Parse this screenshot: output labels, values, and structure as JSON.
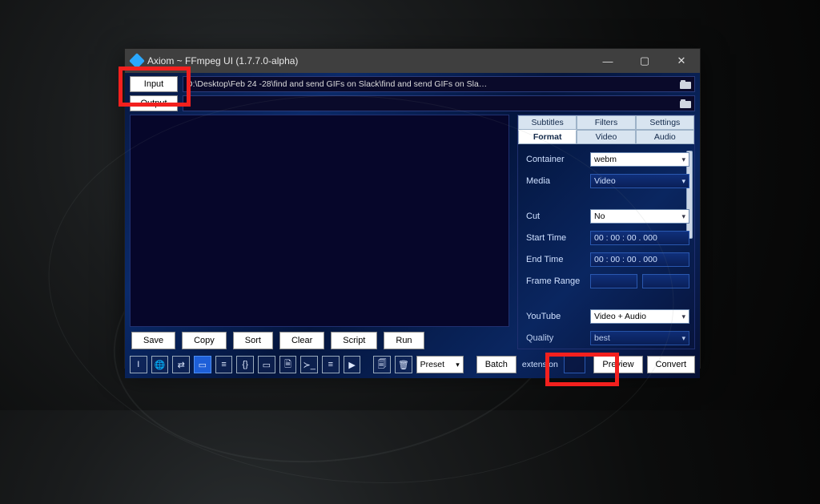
{
  "window": {
    "title": "Axiom ~ FFmpeg UI (1.7.7.0-alpha)"
  },
  "io": {
    "input_label": "Input",
    "input_path": "D:\\Desktop\\Feb 24 -28\\find and send GIFs on Slack\\find and send GIFs on Sla…",
    "output_label": "Output",
    "output_path": ""
  },
  "actions": {
    "save": "Save",
    "copy": "Copy",
    "sort": "Sort",
    "clear": "Clear",
    "script": "Script",
    "run": "Run"
  },
  "tabs_top": [
    "Subtitles",
    "Filters",
    "Settings"
  ],
  "tabs_bottom": [
    "Format",
    "Video",
    "Audio"
  ],
  "tabs_active_bottom": "Format",
  "settings": {
    "container_label": "Container",
    "container_value": "webm",
    "media_label": "Media",
    "media_value": "Video",
    "cut_label": "Cut",
    "cut_value": "No",
    "start_label": "Start Time",
    "start_value": "00 : 00 : 00 . 000",
    "end_label": "End Time",
    "end_value": "00 : 00 : 00 . 000",
    "frame_label": "Frame Range",
    "frame_a": "",
    "frame_b": "",
    "youtube_label": "YouTube",
    "youtube_value": "Video + Audio",
    "quality_label": "Quality",
    "quality_value": "best"
  },
  "bottom": {
    "preset_label": "Preset",
    "batch": "Batch",
    "extension_label": "extension",
    "preview": "Preview",
    "convert": "Convert",
    "icons": [
      "I",
      "🌐",
      "⇄",
      "▭",
      "≡",
      "{}",
      "▭",
      "🗎",
      "≻_",
      "≡",
      "▶"
    ],
    "icons2": [
      "🗐",
      "🗑"
    ]
  }
}
